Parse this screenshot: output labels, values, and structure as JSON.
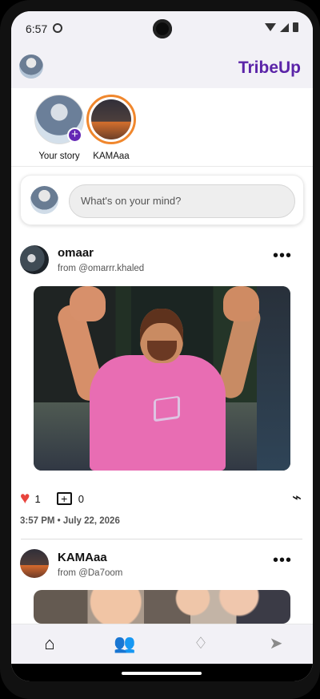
{
  "status": {
    "time": "6:57"
  },
  "app": {
    "name": "TribeUp"
  },
  "stories": [
    {
      "label": "Your story",
      "has_add": true
    },
    {
      "label": "KAMAaa"
    }
  ],
  "composer": {
    "placeholder": "What's on your mind?"
  },
  "posts": [
    {
      "name": "omaar",
      "handle": "from @omarrr.khaled",
      "likes": "1",
      "comments": "0",
      "timestamp": "3:57 PM • July 22, 2026"
    },
    {
      "name": "KAMAaa",
      "handle": "from @Da7oom"
    }
  ],
  "icons": {
    "add": "plus-icon",
    "like": "heart-icon",
    "comment": "comment-icon",
    "link": "link-icon",
    "more": "more-horizontal-icon"
  },
  "colors": {
    "brand": "#5b24a8",
    "accent": "#6428b5",
    "like": "#e8443d",
    "story_ring": "#f0872d"
  }
}
